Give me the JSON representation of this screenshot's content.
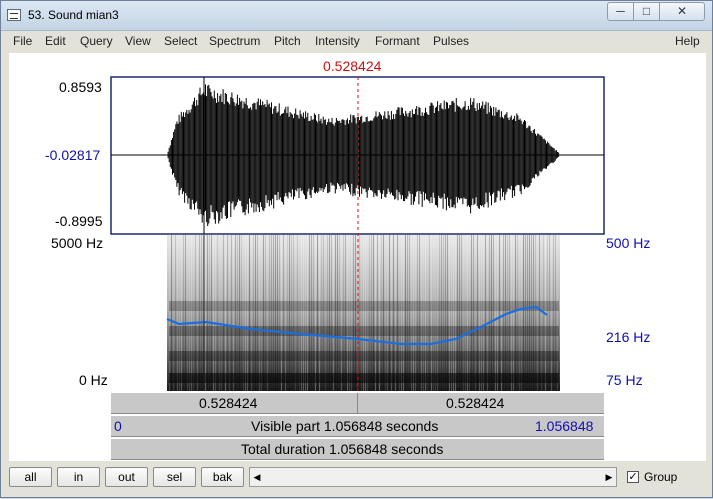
{
  "window": {
    "title": "53. Sound mian3",
    "min_glyph": "─",
    "max_glyph": "□",
    "close_glyph": "✕"
  },
  "menu": [
    "File",
    "Edit",
    "Query",
    "View",
    "Select",
    "Spectrum",
    "Pitch",
    "Intensity",
    "Formant",
    "Pulses",
    "Help"
  ],
  "cursor": {
    "time_label": "0.528424"
  },
  "waveform": {
    "max_label": "0.8593",
    "cursor_value_label": "-0.02817",
    "min_label": "-0.8995"
  },
  "spectrogram": {
    "freq_max_label": "5000 Hz",
    "freq_min_label": "0 Hz"
  },
  "pitch": {
    "max_label": "500 Hz",
    "cursor_value_label": "216 Hz",
    "min_label": "75 Hz"
  },
  "bars": {
    "left_segment": "0.528424",
    "right_segment": "0.528424",
    "visible_start": "0",
    "visible_label": "Visible part 1.056848 seconds",
    "visible_end": "1.056848",
    "total_label": "Total duration 1.056848 seconds"
  },
  "toolbar": {
    "all": "all",
    "in": "in",
    "out": "out",
    "sel": "sel",
    "bak": "bak",
    "group_label": "Group",
    "group_checked": true
  },
  "colors": {
    "cursor": "#d01010",
    "pitch_curve": "#1a6fe0",
    "blue_labels": "#1010b0"
  }
}
